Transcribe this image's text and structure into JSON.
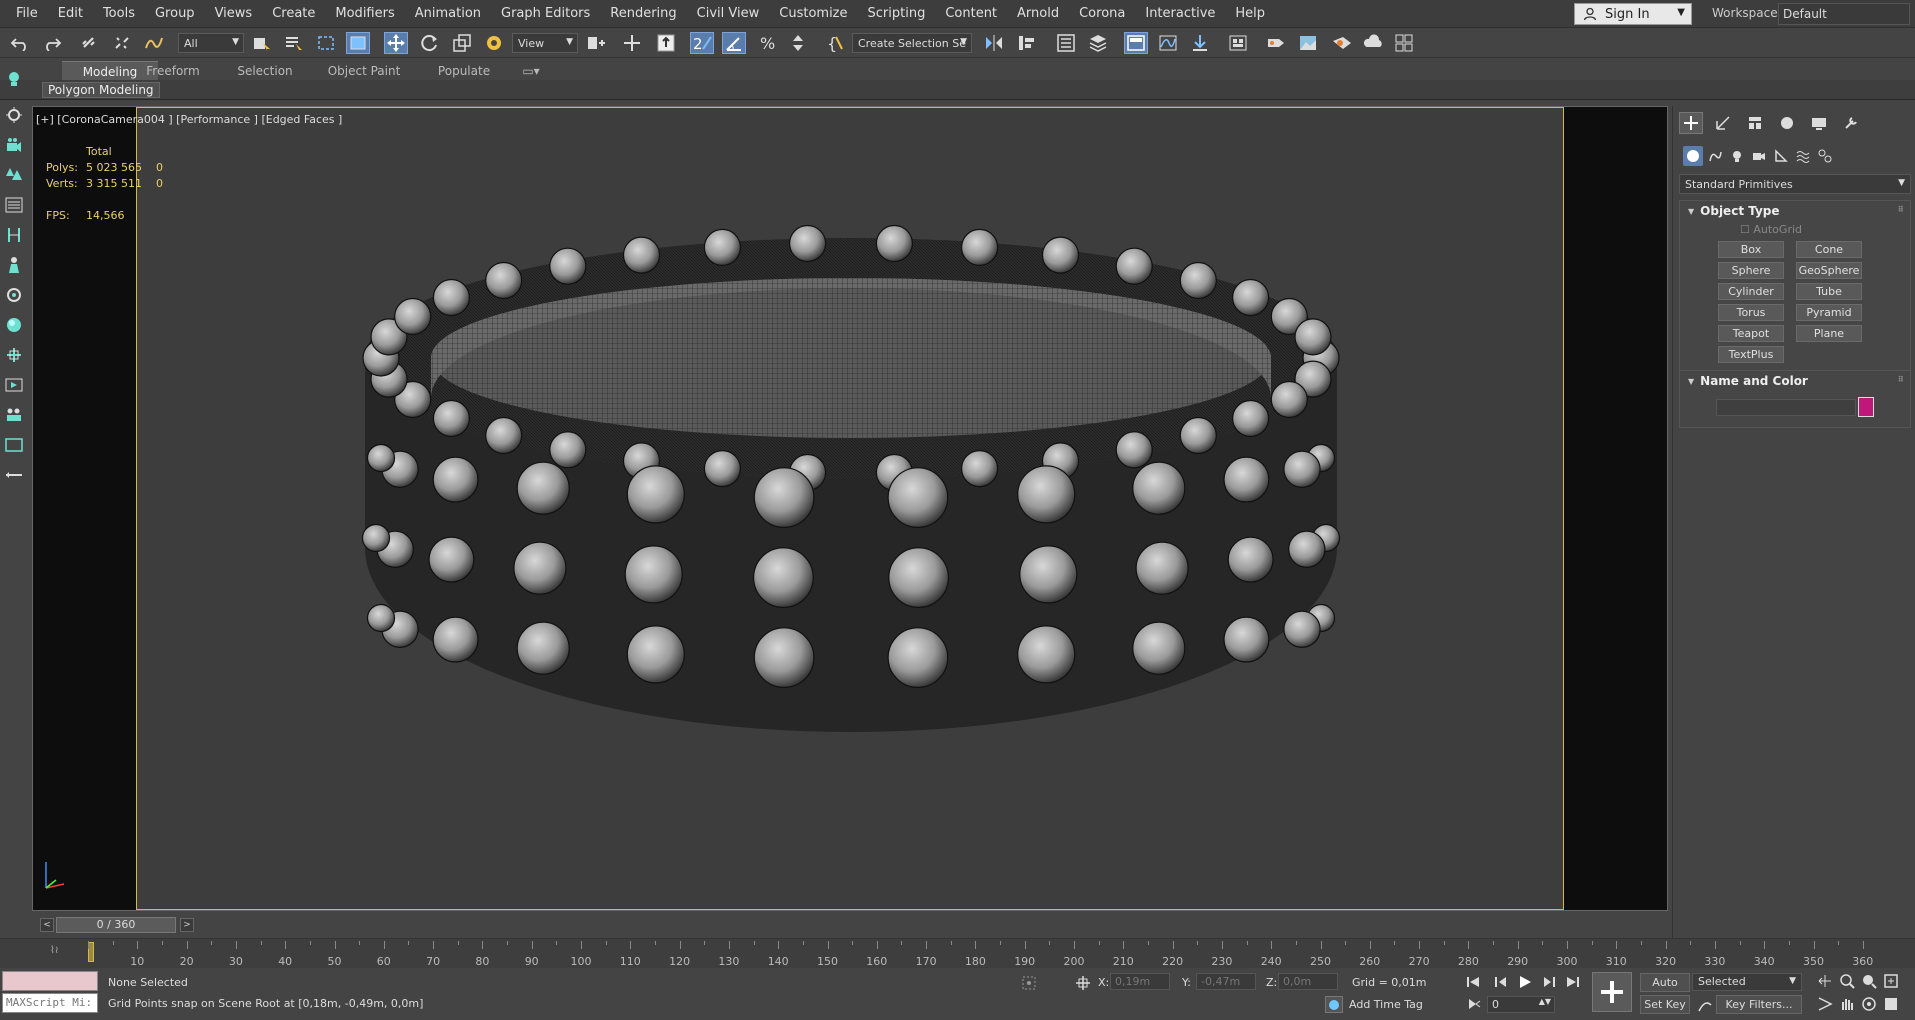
{
  "menubar": {
    "items": [
      "File",
      "Edit",
      "Tools",
      "Group",
      "Views",
      "Create",
      "Modifiers",
      "Animation",
      "Graph Editors",
      "Rendering",
      "Civil View",
      "Customize",
      "Scripting",
      "Content",
      "Arnold",
      "Corona",
      "Interactive",
      "Help"
    ],
    "sign_in": "Sign In",
    "workspaces_label": "Workspaces:",
    "workspace_value": "Default"
  },
  "toolbar": {
    "filter_value": "All",
    "view_value": "View",
    "selection_set_value": "Create Selection Se",
    "accent_color": "#5a7dab"
  },
  "ribbon": {
    "tabs": [
      "Modeling",
      "Freeform",
      "Selection",
      "Object Paint",
      "Populate"
    ],
    "sub_label": "Polygon Modeling"
  },
  "viewport": {
    "label": "[+] [CoronaCamera004 ] [Performance ] [Edged Faces ]",
    "stats": {
      "header": "Total",
      "polys_label": "Polys:",
      "polys_value": "5 023 565",
      "polys_sel": "0",
      "verts_label": "Verts:",
      "verts_value": "3 315 511",
      "verts_sel": "0",
      "fps_label": "FPS:",
      "fps_value": "14,566"
    },
    "frame_color": "#d4b84a"
  },
  "command_panel": {
    "primitives_dropdown": "Standard Primitives",
    "object_type": {
      "title": "Object Type",
      "autogrid": "AutoGrid",
      "buttons": [
        "Box",
        "Cone",
        "Sphere",
        "GeoSphere",
        "Cylinder",
        "Tube",
        "Torus",
        "Pyramid",
        "Teapot",
        "Plane",
        "TextPlus"
      ]
    },
    "name_color": {
      "title": "Name and Color",
      "color": "#c0187a"
    }
  },
  "timeline": {
    "slider_label": "0 / 360",
    "ticks": [
      "10",
      "20",
      "30",
      "40",
      "50",
      "60",
      "70",
      "80",
      "90",
      "100",
      "110",
      "120",
      "130",
      "140",
      "150",
      "160",
      "170",
      "180",
      "190",
      "200",
      "210",
      "220",
      "230",
      "240",
      "250",
      "260",
      "270",
      "280",
      "290",
      "300",
      "310",
      "320",
      "330",
      "340",
      "350",
      "360"
    ]
  },
  "status": {
    "maxscript": "MAXScript Mi:",
    "selection": "None Selected",
    "prompt": "Grid Points snap on Scene Root at [0,18m, -0,49m, 0,0m]",
    "x_label": "X:",
    "x_value": "0,19m",
    "y_label": "Y:",
    "y_value": "-0,47m",
    "z_label": "Z:",
    "z_value": "0,0m",
    "grid": "Grid = 0,01m",
    "add_time_tag": "Add Time Tag",
    "frame_value": "0",
    "auto_key": "Auto Key",
    "set_key": "Set Key",
    "selected_dropdown": "Selected",
    "key_filters": "Key Filters..."
  }
}
